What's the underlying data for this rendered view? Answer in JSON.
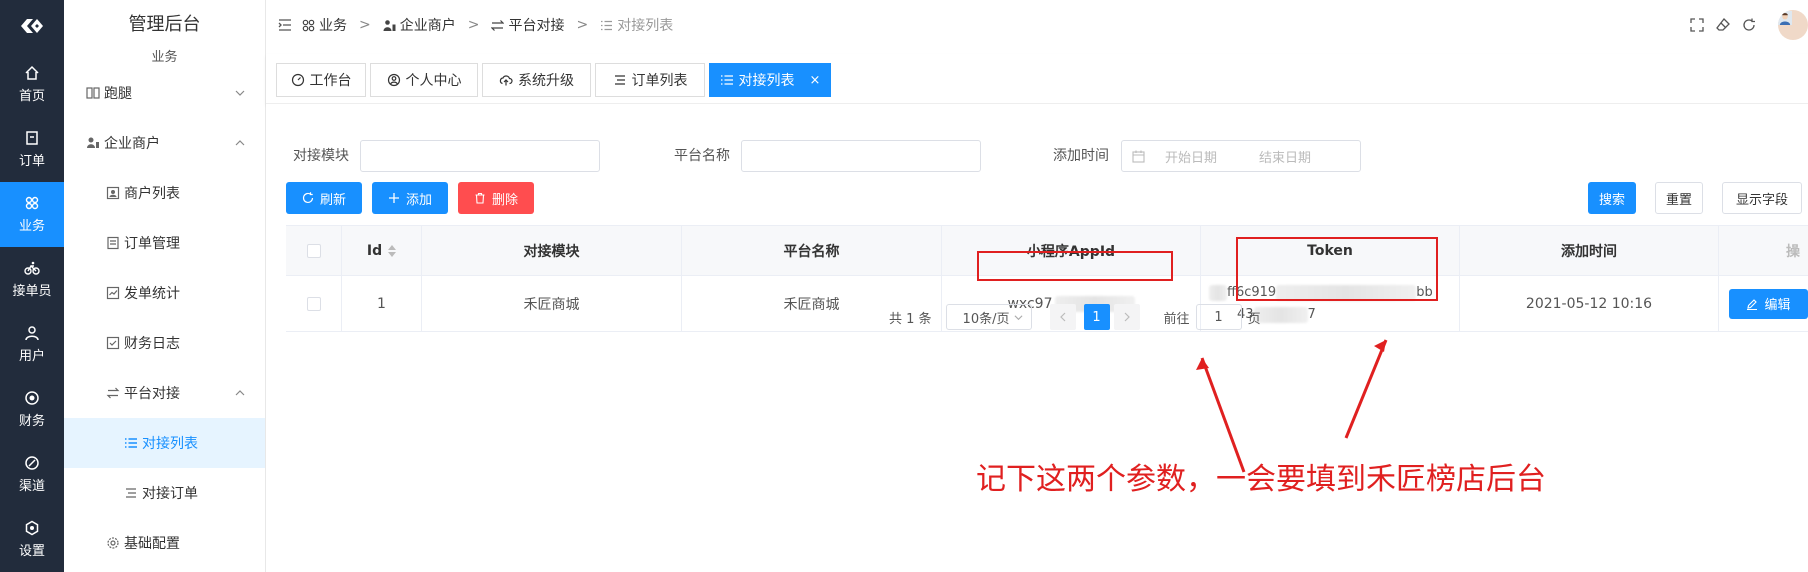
{
  "rail": {
    "items": [
      {
        "label": "首页",
        "icon": "home-icon"
      },
      {
        "label": "订单",
        "icon": "order-icon"
      },
      {
        "label": "业务",
        "icon": "business-icon",
        "active": true
      },
      {
        "label": "接单员",
        "icon": "bike-icon"
      },
      {
        "label": "用户",
        "icon": "user-icon"
      },
      {
        "label": "财务",
        "icon": "finance-icon"
      },
      {
        "label": "渠道",
        "icon": "channel-icon"
      },
      {
        "label": "设置",
        "icon": "settings-icon"
      }
    ]
  },
  "sidebar": {
    "title": "管理后台",
    "subtitle": "业务",
    "items": [
      {
        "label": "跑腿"
      },
      {
        "label": "企业商户"
      },
      {
        "label": "商户列表"
      },
      {
        "label": "订单管理"
      },
      {
        "label": "发单统计"
      },
      {
        "label": "财务日志"
      },
      {
        "label": "平台对接"
      },
      {
        "label": "对接列表"
      },
      {
        "label": "对接订单"
      },
      {
        "label": "基础配置"
      }
    ]
  },
  "breadcrumb": {
    "items": [
      "业务",
      "企业商户",
      "平台对接",
      "对接列表"
    ],
    "separator": ">"
  },
  "tabs": [
    {
      "label": "工作台"
    },
    {
      "label": "个人中心"
    },
    {
      "label": "系统升级"
    },
    {
      "label": "订单列表"
    },
    {
      "label": "对接列表",
      "close": "×"
    }
  ],
  "filters": {
    "module_label": "对接模块",
    "platform_label": "平台名称",
    "time_label": "添加时间",
    "start_placeholder": "开始日期",
    "end_placeholder": "结束日期"
  },
  "toolbar": {
    "refresh": "刷新",
    "add": "添加",
    "delete": "删除",
    "search": "搜索",
    "reset": "重置",
    "columns": "显示字段"
  },
  "table": {
    "headers": {
      "id": "Id",
      "module": "对接模块",
      "platform": "平台名称",
      "appid": "小程序AppId",
      "token": "Token",
      "time": "添加时间",
      "ops": "操"
    },
    "rows": [
      {
        "id": "1",
        "module": "禾匠商城",
        "platform": "禾匠商城",
        "appid": "wxc97",
        "token_line1a": "ff6c919",
        "token_line1b": "bb",
        "token_line2a": "43",
        "token_line2b": "7",
        "time": "2021-05-12 10:16",
        "edit": "编辑"
      }
    ]
  },
  "pagination": {
    "total": "共 1 条",
    "page_size": "10条/页",
    "current": "1",
    "goto_label": "前往",
    "goto_value": "1",
    "page_unit": "页"
  },
  "annotation": "记下这两个参数，一会要填到禾匠榜店后台",
  "colors": {
    "primary": "#1890ff",
    "danger": "#ff4d4f",
    "rail": "#222c3c",
    "annotation": "#e02020"
  }
}
